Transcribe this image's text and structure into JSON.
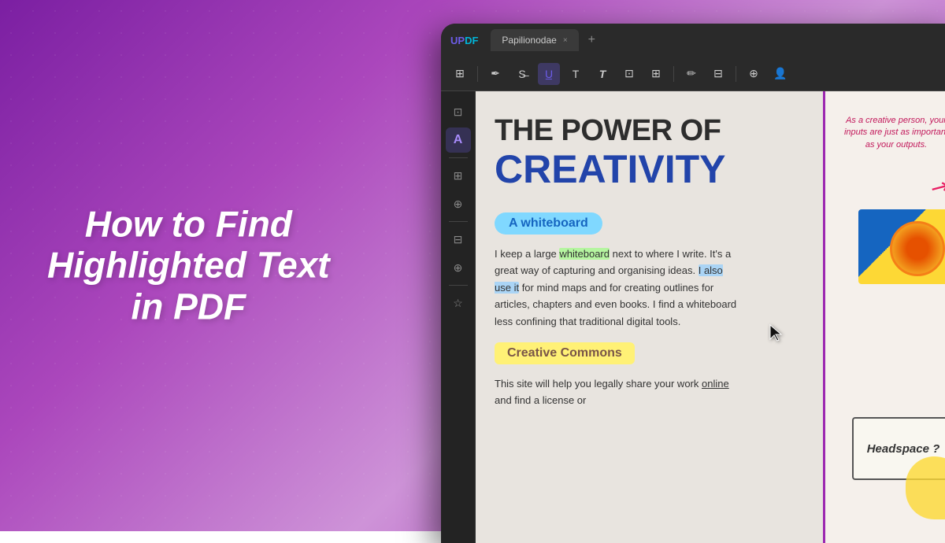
{
  "app": {
    "name": "UPDF",
    "tab_title": "Papilionodae",
    "tab_close": "×",
    "tab_add": "+"
  },
  "left_title": {
    "line1": "How to Find",
    "line2": "Highlighted Text",
    "line3": "in PDF"
  },
  "toolbar": {
    "icons": [
      "⊞",
      "✏",
      "S̶",
      "U̲",
      "T",
      "T",
      "⊡",
      "⊞",
      "✏",
      "⊡",
      "⊕",
      "👤"
    ]
  },
  "sidebar": {
    "icons": [
      "⊡",
      "A",
      "⊞",
      "⊕",
      "⊟",
      "⊕",
      "☆"
    ]
  },
  "pdf": {
    "title_main": "THE POWER OF",
    "title_creativity": "CREATIVITY",
    "whiteboard_badge": "A whiteboard",
    "body_text": "I keep a large whiteboard next to where I write. It's a great way of capturing and organising ideas.",
    "highlight_text": "I also use it",
    "body_text2": "for mind maps and for creating outlines for articles, chapters and even books. I find a whiteboard less confining that traditional digital tools.",
    "creative_commons": "Creative Commons",
    "body_text3": "This site will help you legally share your work",
    "link_text": "online",
    "body_text4": "and find a license or"
  },
  "right_deco": {
    "quote": "As a creative person, your inputs are just as important as your outputs.",
    "headspace": "Headspace ?"
  }
}
